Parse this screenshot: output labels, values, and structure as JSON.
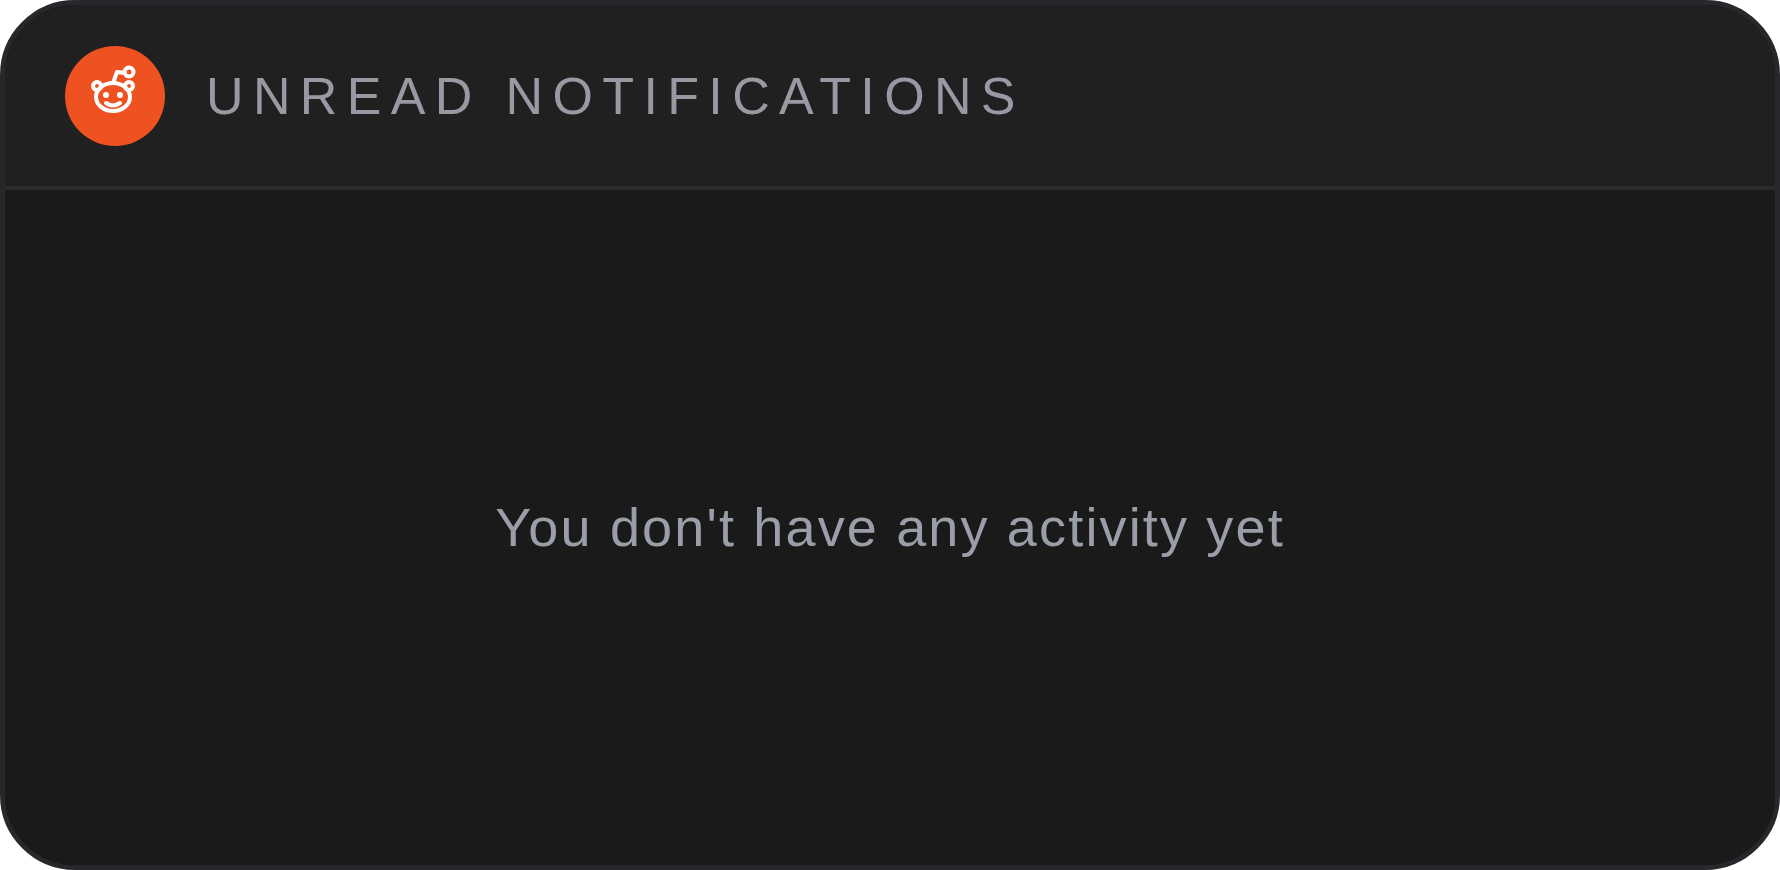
{
  "header": {
    "title": "UNREAD NOTIFICATIONS"
  },
  "empty_state": {
    "message": "You don't have any activity yet"
  }
}
